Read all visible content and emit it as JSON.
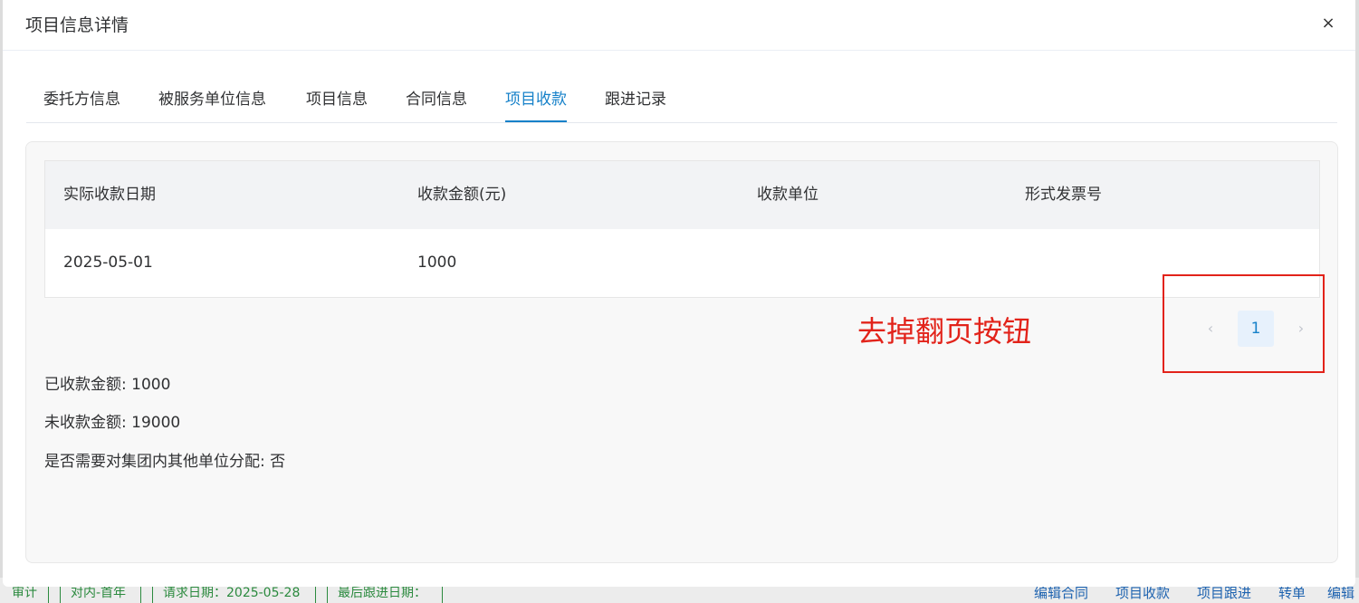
{
  "background": {
    "items": [
      "审计",
      "对内-首年",
      "请求日期：2025-05-28",
      "最后跟进日期："
    ],
    "links": [
      "编辑合同",
      "项目收款",
      "项目跟进",
      "转单",
      "编辑"
    ]
  },
  "modal": {
    "title": "项目信息详情",
    "close_icon": "×"
  },
  "tabs": [
    {
      "label": "委托方信息"
    },
    {
      "label": "被服务单位信息"
    },
    {
      "label": "项目信息"
    },
    {
      "label": "合同信息"
    },
    {
      "label": "项目收款"
    },
    {
      "label": "跟进记录"
    }
  ],
  "active_tab": "项目收款",
  "table": {
    "headers": [
      "实际收款日期",
      "收款金额(元)",
      "收款单位",
      "形式发票号"
    ],
    "rows": [
      [
        "2025-05-01",
        "1000",
        "",
        ""
      ]
    ]
  },
  "pagination": {
    "prev_icon": "‹",
    "current_page": "1",
    "next_icon": "›"
  },
  "annotation": {
    "text": "去掉翻页按钮",
    "color": "#e2231a"
  },
  "summary": {
    "received": "已收款金额: 1000",
    "unreceived": "未收款金额: 19000",
    "allocate": "是否需要对集团内其他单位分配: 否"
  },
  "colors": {
    "accent": "#1681c9",
    "annotation": "#e2231a",
    "background_text": "#2b8a3e"
  }
}
